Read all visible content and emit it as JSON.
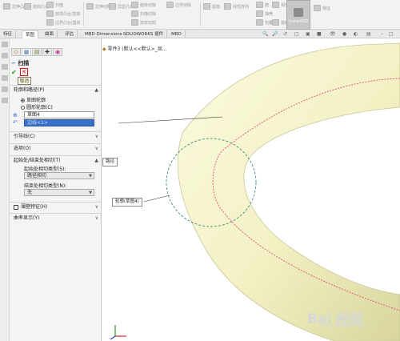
{
  "ribbon": {
    "buttons": [
      {
        "label": "拉伸凸台",
        "icon": "extrude-icon"
      },
      {
        "label": "旋转凸台",
        "icon": "revolve-icon"
      },
      {
        "label": "扫描",
        "icon": "sweep-icon"
      },
      {
        "label": "放样凸台/基体",
        "icon": "loft-icon"
      },
      {
        "label": "边界凸台/基体",
        "icon": "boundary-icon"
      },
      {
        "label": "拉伸切除",
        "icon": "extrude-cut-icon"
      },
      {
        "label": "异型孔向导",
        "icon": "hole-wizard-icon"
      },
      {
        "label": "旋转切除",
        "icon": "revolve-cut-icon"
      },
      {
        "label": "扫描切除",
        "icon": "sweep-cut-icon"
      },
      {
        "label": "放样切割",
        "icon": "loft-cut-icon"
      },
      {
        "label": "边界切除",
        "icon": "boundary-cut-icon"
      },
      {
        "label": "圆角",
        "icon": "fillet-icon"
      },
      {
        "label": "线性阵列",
        "icon": "linear-pattern-icon"
      },
      {
        "label": "筋",
        "icon": "rib-icon"
      },
      {
        "label": "抽壳",
        "icon": "shell-icon"
      },
      {
        "label": "包覆",
        "icon": "wrap-icon"
      },
      {
        "label": "相交",
        "icon": "intersect-icon"
      },
      {
        "label": "镜向",
        "icon": "mirror-icon"
      },
      {
        "label": "参考几何体",
        "icon": "reference-geometry-icon"
      },
      {
        "label": "曲线",
        "icon": "curves-icon"
      }
    ],
    "instant3d": "Instant3D",
    "extra": "特征"
  },
  "tabs": [
    "特征",
    "草图",
    "曲面",
    "评估",
    "MBD Dimensions",
    "SOLIDWORKS 插件",
    "MBD"
  ],
  "tree_line": "零件3 (默认<<默认>_显...",
  "property_manager": {
    "title": "扫描",
    "ok_symbol": "✔",
    "cancel_symbol": "✕",
    "tooltip": "取消",
    "profile_section": "轮廓和路径(P)",
    "radio_sketch": "草图轮廓",
    "radio_circle": "圆形轮廓(C)",
    "profile_value": "草图4",
    "path_value": "边线<1>",
    "guide_curves": "引导线(C)",
    "options": "选项(O)",
    "tangency_section": "起始处/结束处相切(T)",
    "start_label": "起始处相切类型(S):",
    "start_value": "路径相切",
    "end_label": "结束处相切类型(N):",
    "end_value": "无",
    "thin_feature": "薄壁特征(H)",
    "curvature": "曲率显示(Y)"
  },
  "viewport": {
    "callout_path": "路径",
    "callout_profile": "轮廓(草图4)",
    "watermark": "Bai 经验",
    "watermark_sub": "jingyan.baidu.com"
  },
  "colors": {
    "torus_fill": "#f5f3c8",
    "torus_shade": "#d9d7a0",
    "path_line": "#e0507a",
    "circle_profile": "#3c8f82",
    "selection": "#3a70c8",
    "ok_green": "#1d9a1d",
    "cancel_red": "#d01a1a"
  }
}
